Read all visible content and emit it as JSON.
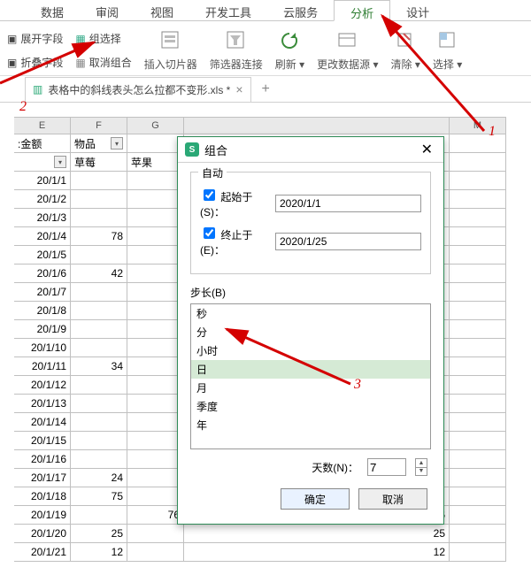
{
  "tabs": [
    "数据",
    "审阅",
    "视图",
    "开发工具",
    "云服务",
    "分析",
    "设计"
  ],
  "active_tab": "分析",
  "ribbon": {
    "expand": "展开字段",
    "collapse": "折叠字段",
    "group_sel": "组选择",
    "ungroup": "取消组合",
    "slicer": "插入切片器",
    "filter_conn": "筛选器连接",
    "refresh": "刷新",
    "change_source": "更改数据源",
    "clear": "清除",
    "select": "选择"
  },
  "doc_tab": "表格中的斜线表头怎么拉都不变形.xls *",
  "col_headers": [
    "E",
    "F",
    "G",
    "M"
  ],
  "header_row": {
    "E": ":金额",
    "F": "物品",
    "G": "",
    "sub_f": "草莓",
    "sub_g": "苹果"
  },
  "data_rows": [
    {
      "date": "20/1/1",
      "f": "",
      "g": ""
    },
    {
      "date": "20/1/2",
      "f": "",
      "g": ""
    },
    {
      "date": "20/1/3",
      "f": "",
      "g": ""
    },
    {
      "date": "20/1/4",
      "f": "78",
      "g": ""
    },
    {
      "date": "20/1/5",
      "f": "",
      "g": ""
    },
    {
      "date": "20/1/6",
      "f": "42",
      "g": ""
    },
    {
      "date": "20/1/7",
      "f": "",
      "g": ""
    },
    {
      "date": "20/1/8",
      "f": "",
      "g": ""
    },
    {
      "date": "20/1/9",
      "f": "",
      "g": ""
    },
    {
      "date": "20/1/10",
      "f": "",
      "g": ""
    },
    {
      "date": "20/1/11",
      "f": "34",
      "g": ""
    },
    {
      "date": "20/1/12",
      "f": "",
      "g": ""
    },
    {
      "date": "20/1/13",
      "f": "",
      "g": ""
    },
    {
      "date": "20/1/14",
      "f": "",
      "g": ""
    },
    {
      "date": "20/1/15",
      "f": "",
      "g": ""
    },
    {
      "date": "20/1/16",
      "f": "",
      "g": ""
    },
    {
      "date": "20/1/17",
      "f": "24",
      "g": ""
    },
    {
      "date": "20/1/18",
      "f": "75",
      "g": ""
    },
    {
      "date": "20/1/19",
      "f": "",
      "g": "76",
      "h_extra": "76"
    },
    {
      "date": "20/1/20",
      "f": "25",
      "g": "",
      "h_extra": "25"
    },
    {
      "date": "20/1/21",
      "f": "12",
      "g": "",
      "h_extra": "12"
    }
  ],
  "dialog": {
    "title": "组合",
    "auto": "自动",
    "start_label": "起始于(S)：",
    "start_value": "2020/1/1",
    "end_label": "终止于(E)：",
    "end_value": "2020/1/25",
    "step_label": "步长(B)",
    "step_options": [
      "秒",
      "分",
      "小时",
      "日",
      "月",
      "季度",
      "年"
    ],
    "step_selected": "日",
    "days_label": "天数(N)：",
    "days_value": "7",
    "ok": "确定",
    "cancel": "取消"
  },
  "annotations": {
    "one": "1",
    "two": "2",
    "three": "3"
  }
}
